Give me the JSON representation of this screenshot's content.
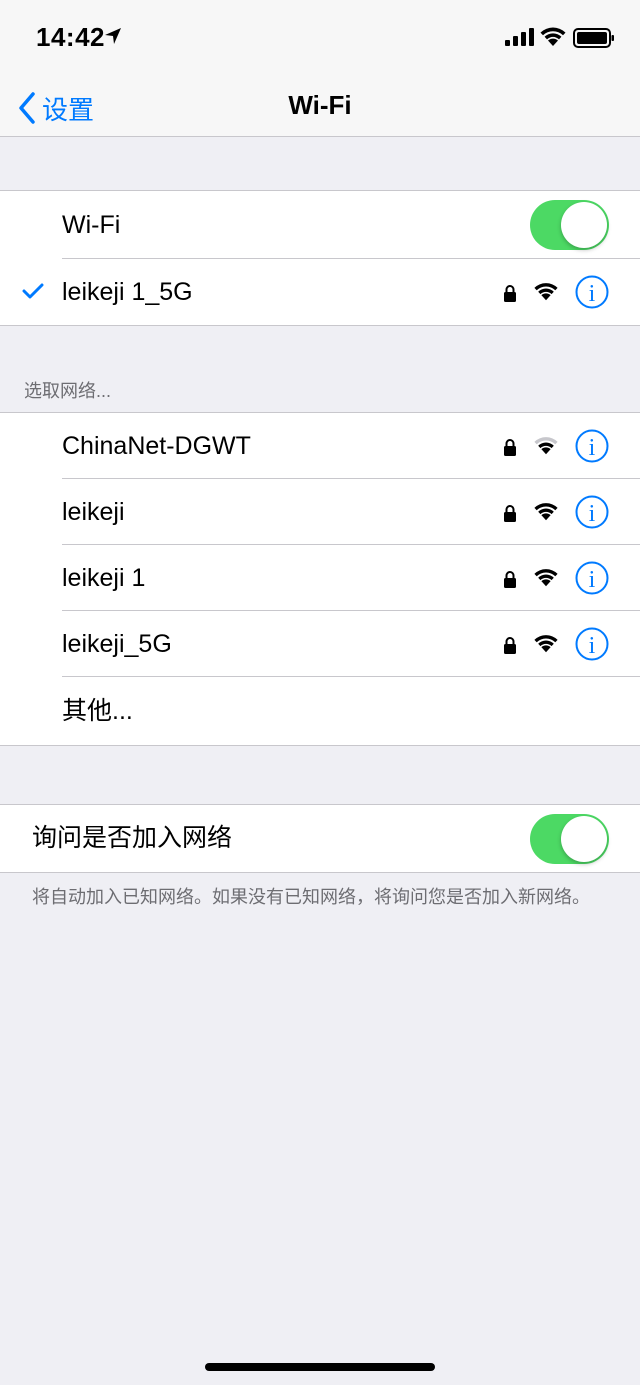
{
  "status": {
    "time": "14:42"
  },
  "nav": {
    "back_label": "设置",
    "title": "Wi-Fi"
  },
  "wifi_toggle": {
    "label": "Wi-Fi",
    "on": true
  },
  "connected": {
    "name": "leikeji 1_5G"
  },
  "networks_header": "选取网络...",
  "networks": [
    {
      "name": "ChinaNet-DGWT",
      "signal": "weak"
    },
    {
      "name": "leikeji",
      "signal": "full"
    },
    {
      "name": "leikeji 1",
      "signal": "full"
    },
    {
      "name": "leikeji_5G",
      "signal": "full"
    }
  ],
  "other_label": "其他...",
  "ask_join": {
    "label": "询问是否加入网络",
    "on": true
  },
  "footer_note": "将自动加入已知网络。如果没有已知网络，将询问您是否加入新网络。",
  "colors": {
    "accent": "#007aff",
    "toggle_on": "#4cd964",
    "background": "#efeff4"
  }
}
